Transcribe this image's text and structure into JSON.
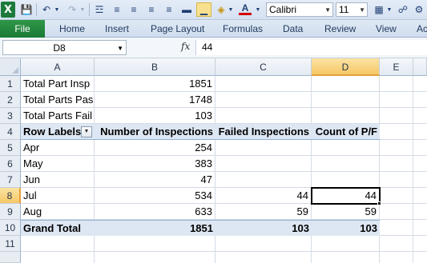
{
  "quick_access": {
    "app_icon": "excel-logo",
    "font_name": "Calibri",
    "font_size": "11",
    "icons": [
      "save-icon",
      "undo-icon",
      "redo-icon",
      "format-painter-icon",
      "align-left-icon",
      "align-center-icon",
      "align-right-icon",
      "justify-icon",
      "borders-icon",
      "fill-color-icon",
      "font-color-icon",
      "share-icon",
      "settings-icon"
    ]
  },
  "ribbon": {
    "file_tab": "File",
    "tabs": [
      "Home",
      "Insert",
      "Page Layout",
      "Formulas",
      "Data",
      "Review",
      "View",
      "Ac"
    ]
  },
  "formula_bar": {
    "name_box": "D8",
    "fx_label": "fx",
    "formula": "44"
  },
  "grid": {
    "columns": [
      "A",
      "B",
      "C",
      "D",
      "E"
    ],
    "rows": [
      "1",
      "2",
      "3",
      "4",
      "5",
      "6",
      "7",
      "8",
      "9",
      "10",
      "11"
    ],
    "active_cell": "D8",
    "cells": {
      "A1": "Total Part Insp",
      "B1": "1851",
      "A2": "Total Parts Pas",
      "B2": "1748",
      "A3": "Total Parts Fail",
      "B3": "103",
      "A4": "Row Labels",
      "B4": "Number of Inspections",
      "C4": "Failed Inspections",
      "D4": "Count of P/F",
      "A5": "Apr",
      "B5": "254",
      "A6": "May",
      "B6": "383",
      "A7": "Jun",
      "B7": "47",
      "A8": "Jul",
      "B8": "534",
      "C8": "44",
      "D8": "44",
      "A9": "Aug",
      "B9": "633",
      "C9": "59",
      "D9": "59",
      "A10": "Grand Total",
      "B10": "1851",
      "C10": "103",
      "D10": "103"
    }
  },
  "colors": {
    "file_tab": "#1b7a36",
    "pivot_header_fill": "#dde7f3",
    "selected_header": "#f6c866"
  }
}
